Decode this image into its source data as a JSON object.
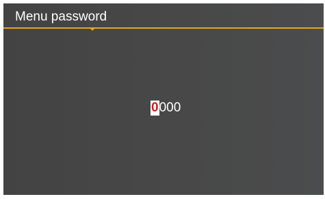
{
  "header": {
    "title": "Menu password"
  },
  "password": {
    "digits": [
      "0",
      "0",
      "0",
      "0"
    ],
    "active_index": 0
  },
  "colors": {
    "accent": "#e4a71c",
    "active_digit_text": "#d81b1b",
    "active_digit_background": "#ffffff",
    "text": "#ffffff"
  }
}
